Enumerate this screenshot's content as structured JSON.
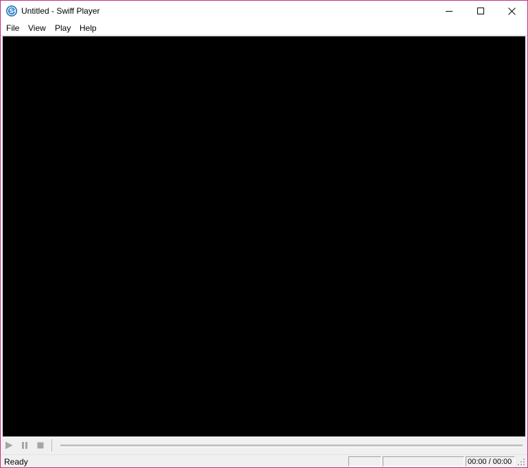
{
  "window": {
    "title": "Untitled - Swiff Player",
    "app_icon": "swiff-player-icon",
    "frame_accent": "#c2307e",
    "buttons": [
      "minimize-icon",
      "maximize-icon",
      "close-icon"
    ]
  },
  "menubar": {
    "items": [
      {
        "label": "File"
      },
      {
        "label": "View"
      },
      {
        "label": "Play"
      },
      {
        "label": "Help"
      }
    ]
  },
  "video": {
    "background": "#000000"
  },
  "controls": {
    "icons": [
      "play-icon",
      "pause-icon",
      "stop-icon"
    ],
    "seek_progress": 0
  },
  "statusbar": {
    "status": "Ready",
    "time": "00:00 / 00:00"
  }
}
